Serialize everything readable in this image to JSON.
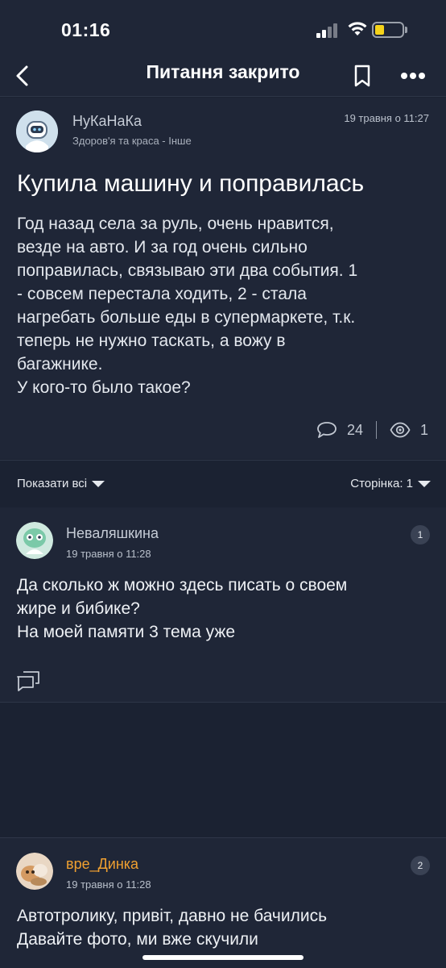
{
  "status_bar": {
    "time": "01:16"
  },
  "nav": {
    "title": "Питання закрито"
  },
  "topic": {
    "author": "НуКаНаКа",
    "category": "Здоров'я та краса - Інше",
    "date": "19 травня о 11:27",
    "title": "Купила машину и поправилась",
    "body_lines": [
      "Год назад села за руль, очень нравится,",
      "везде на авто. И за год очень сильно",
      "поправилась, связываю эти два события. 1",
      "- совсем перестала ходить, 2 - стала",
      "нагребать больше еды в супермаркете, т.к.",
      "теперь не нужно таскать, а вожу в",
      "багажнике.",
      "У кого-то было такое?"
    ],
    "comments_count": "24",
    "views_count": "1"
  },
  "filter": {
    "show_all": "Показати всі",
    "page": "Сторінка: 1"
  },
  "posts": [
    {
      "author": "Неваляшкина",
      "date": "19 травня о 11:28",
      "number": "1",
      "body_lines": [
        "Да сколько ж можно здесь писать о своем",
        "жире и бибике?",
        "На моей памяти 3 тема уже"
      ]
    },
    {
      "author": "вре_Динка",
      "date": "19 травня о 11:28",
      "number": "2",
      "body_lines": [
        "Автотролику, привіт, давно не бачились",
        "Давайте фото, ми вже скучили"
      ]
    }
  ],
  "colors": {
    "background": "#1b2232",
    "card": "#1f2637",
    "accent_author": "#f0a030",
    "battery": "#f5d31a"
  }
}
